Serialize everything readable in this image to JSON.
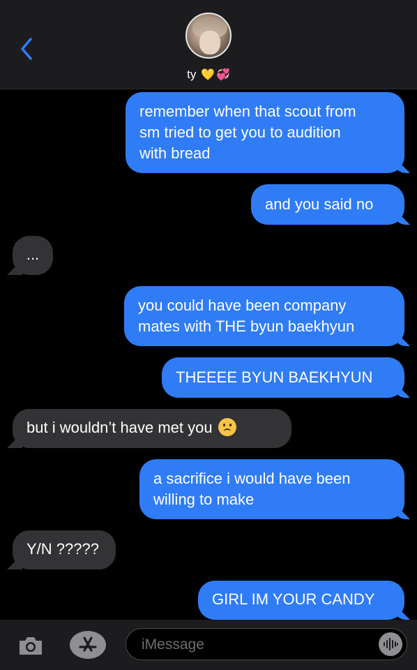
{
  "header": {
    "contact_name": "ty",
    "emoji_1": "💛",
    "emoji_2": "💞",
    "back_icon": "chevron-left-icon",
    "avatar": "contact-photo"
  },
  "messages": [
    {
      "type": "sent",
      "lines": [
        "remember when that scout from",
        "sm tried to get you to audition",
        "with bread"
      ]
    },
    {
      "type": "sent",
      "lines": [
        "and you said no"
      ]
    },
    {
      "type": "received",
      "lines": [
        "..."
      ]
    },
    {
      "type": "sent",
      "lines": [
        "you could have been company",
        "mates with THE byun baekhyun"
      ]
    },
    {
      "type": "sent",
      "lines": [
        "THEEEE BYUN BAEKHYUN"
      ]
    },
    {
      "type": "received",
      "lines": [
        "but i wouldn’t have met you"
      ],
      "emoji": "frowning-face"
    },
    {
      "type": "sent",
      "lines": [
        "a sacrifice i would have been",
        "willing to make"
      ]
    },
    {
      "type": "received",
      "lines": [
        "Y/N ?????"
      ]
    },
    {
      "type": "sent",
      "lines": [
        "GIRL IM YOUR CANDY"
      ]
    }
  ],
  "composer": {
    "placeholder": "iMessage",
    "value": "",
    "camera_icon": "camera-icon",
    "apps_icon": "app-store-icon",
    "audio_icon": "audio-waveform-icon"
  },
  "colors": {
    "sent_bubble": "#2f7cf6",
    "received_bubble": "#333335",
    "background": "#000000",
    "accent": "#2f7cf6"
  }
}
